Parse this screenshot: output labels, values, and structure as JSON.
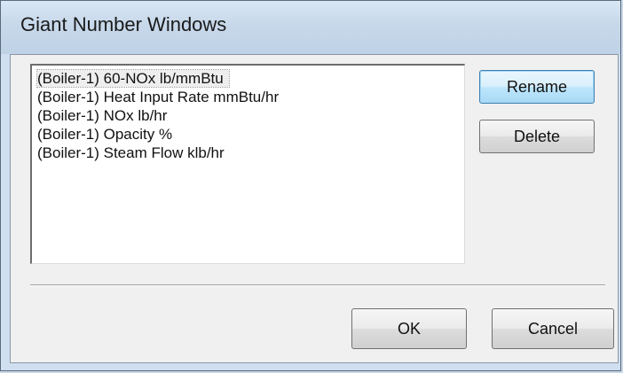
{
  "window": {
    "title": "Giant Number Windows"
  },
  "list": {
    "items": [
      {
        "label": "(Boiler-1) 60-NOx lb/mmBtu",
        "selected": true
      },
      {
        "label": "(Boiler-1) Heat Input Rate mmBtu/hr",
        "selected": false
      },
      {
        "label": "(Boiler-1) NOx lb/hr",
        "selected": false
      },
      {
        "label": "(Boiler-1) Opacity %",
        "selected": false
      },
      {
        "label": "(Boiler-1) Steam Flow  klb/hr",
        "selected": false
      }
    ]
  },
  "buttons": {
    "rename": "Rename",
    "delete": "Delete",
    "ok": "OK",
    "cancel": "Cancel"
  },
  "colors": {
    "titlebar": "#c7d8ea",
    "dialog_bg": "#f0f0f0",
    "focus_border": "#3c7fb1"
  }
}
